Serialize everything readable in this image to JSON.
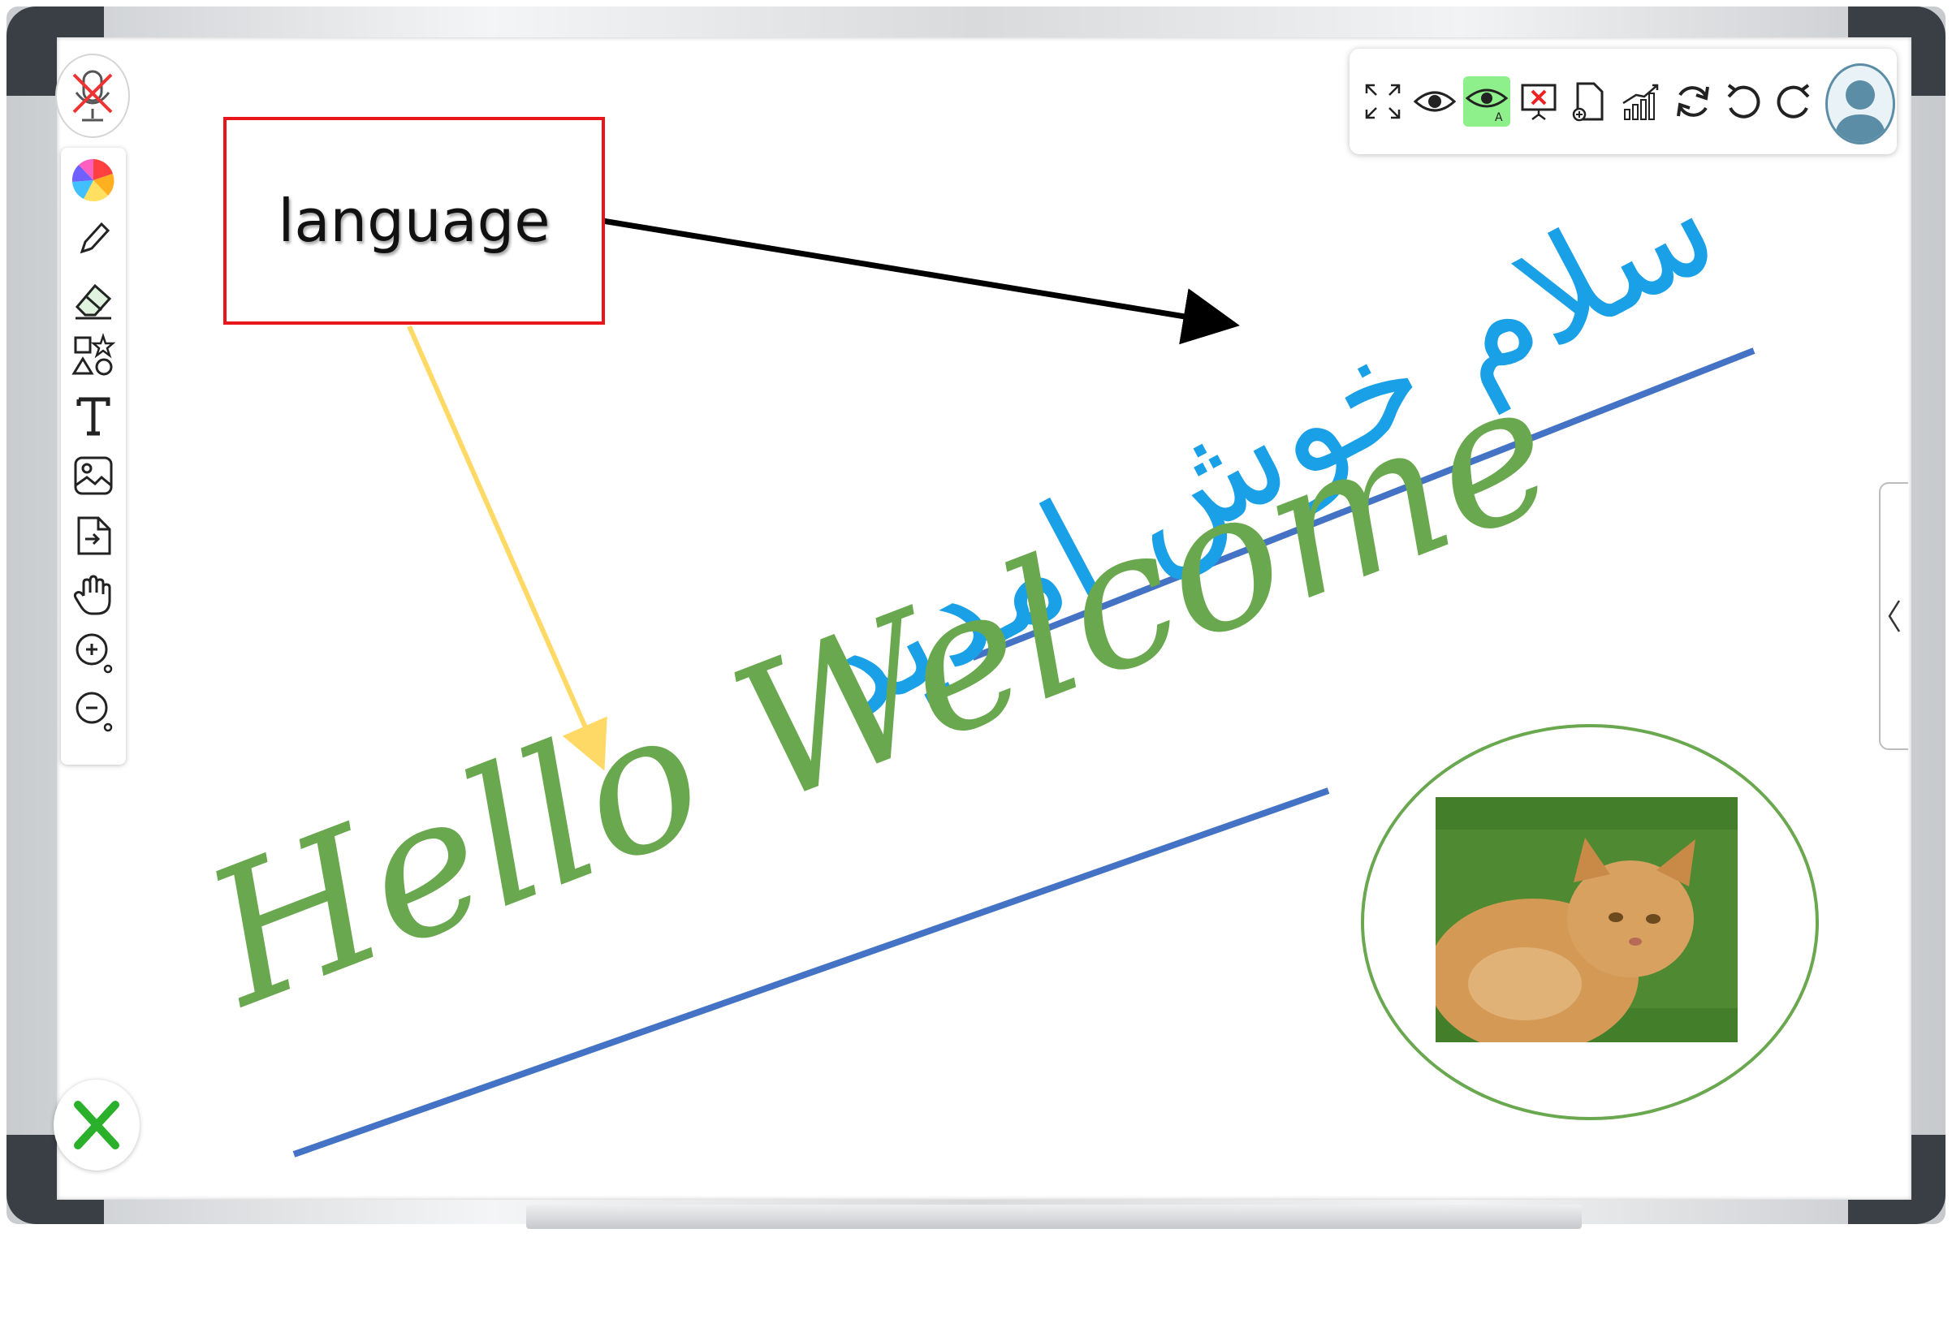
{
  "canvas": {
    "box_label": "language",
    "handwriting_english": "Hello Welcome",
    "handwriting_persian": "سلام خوش امدید"
  },
  "left_toolbar": {
    "icons": [
      "mic-off-icon",
      "color-wheel-icon",
      "pencil-icon",
      "eraser-icon",
      "shapes-icon",
      "text-icon",
      "image-icon",
      "file-import-icon",
      "hand-pan-icon",
      "zoom-in-icon",
      "zoom-out-icon"
    ]
  },
  "top_toolbar": {
    "icons": [
      "fullscreen-icon",
      "view-icon",
      "view-all-icon",
      "close-presentation-icon",
      "add-page-icon",
      "stats-icon",
      "refresh-icon",
      "undo-icon",
      "redo-icon",
      "user-avatar-icon"
    ],
    "active_icon": "view-all-icon"
  },
  "colors": {
    "box_border": "#e8161b",
    "english_ink": "#6aa84f",
    "persian_ink": "#1aa0e6",
    "underline": "#4472c4",
    "arrow_black": "#000000",
    "arrow_yellow": "#ffd966",
    "active_tool": "#8ef08a",
    "close_x": "#2bb02b"
  }
}
